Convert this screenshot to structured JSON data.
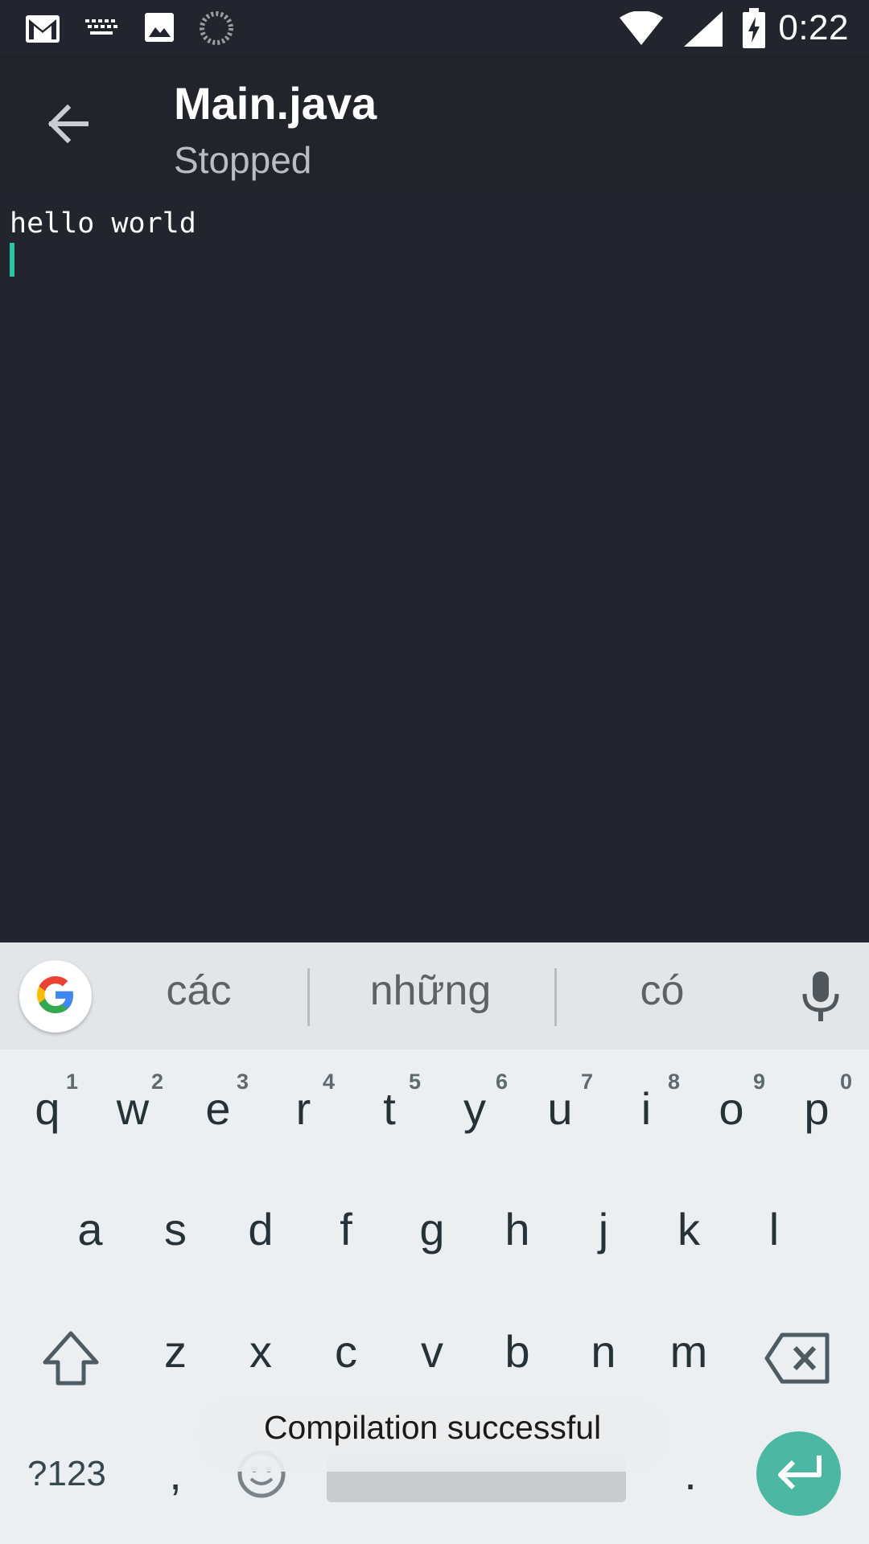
{
  "status_bar": {
    "time": "0:22",
    "icons_left": [
      "gmail-icon",
      "keyboard-icon",
      "image-icon",
      "loading-icon"
    ],
    "icons_right": [
      "wifi-icon",
      "signal-icon",
      "battery-charging-icon"
    ]
  },
  "app_bar": {
    "back_icon": "arrow-back-icon",
    "title": "Main.java",
    "subtitle": "Stopped"
  },
  "console": {
    "output": "hello world",
    "cursor_color": "#2ec4a4"
  },
  "keyboard": {
    "suggestions": [
      "các",
      "những",
      "có"
    ],
    "row1": [
      {
        "key": "q",
        "hint": "1"
      },
      {
        "key": "w",
        "hint": "2"
      },
      {
        "key": "e",
        "hint": "3"
      },
      {
        "key": "r",
        "hint": "4"
      },
      {
        "key": "t",
        "hint": "5"
      },
      {
        "key": "y",
        "hint": "6"
      },
      {
        "key": "u",
        "hint": "7"
      },
      {
        "key": "i",
        "hint": "8"
      },
      {
        "key": "o",
        "hint": "9"
      },
      {
        "key": "p",
        "hint": "0"
      }
    ],
    "row2": [
      "a",
      "s",
      "d",
      "f",
      "g",
      "h",
      "j",
      "k",
      "l"
    ],
    "row3": [
      "z",
      "x",
      "c",
      "v",
      "b",
      "n",
      "m"
    ],
    "symbols_label": "?123",
    "comma": ",",
    "period": ".",
    "accent_color": "#4cb8a3"
  },
  "toast": {
    "message": "Compilation successful"
  }
}
